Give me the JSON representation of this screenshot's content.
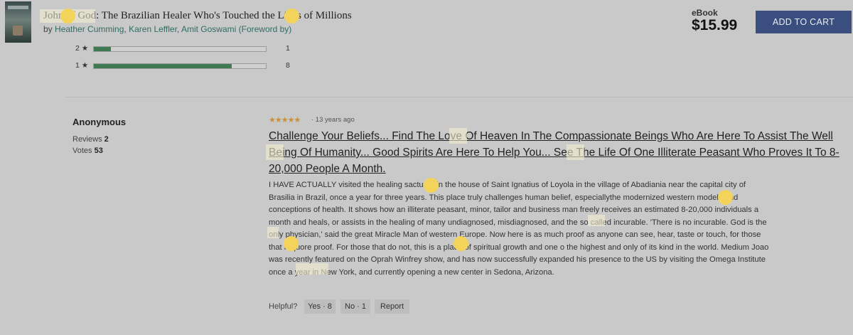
{
  "header": {
    "title": "John of God: The Brazilian Healer Who's Touched the Lives of Millions",
    "by_prefix": "by",
    "authors": [
      "Heather Cumming",
      "Karen Leffler",
      "Amit Goswami (Foreword by)"
    ],
    "separator": ",",
    "format": "eBook",
    "price": "$15.99",
    "add_to_cart": "ADD TO CART"
  },
  "ratings": [
    {
      "label": "2 ★",
      "count": "1",
      "fraction": 0.1
    },
    {
      "label": "1 ★",
      "count": "8",
      "fraction": 0.8
    }
  ],
  "reviewer": {
    "name": "Anonymous",
    "reviews_label": "Reviews",
    "reviews_count": "2",
    "votes_label": "Votes",
    "votes_count": "53"
  },
  "review": {
    "stars": "★★★★★",
    "stars_value": 5,
    "stars_color": "#c9913a",
    "ago": "· 13 years ago",
    "title": "Challenge Your Beliefs... Find The Love Of Heaven In The Compassionate Beings Who Are Here To Assist The Well Being Of Humanity... Good Spirits Are Here To Help You... See The Life Of One Illiterate Peasant Who Proves It To 8-20,000 People A Month.",
    "body": "I HAVE ACTUALLY visited the healing sactuary in the house of Saint Ignatius of Loyola in the village of Abadiania near the capital city of Brasilia in Brazil, once a year for three years. This place truly challenges human belief, especiallythe modernized western models and conceptions of health. It shows how an illiterate peasant, minor, tailor and business man freely receives an estimated 8-20,000 individuals a month and heals, or assists in the healing of many undiagnosed, misdiagnosed, and the so called incurable. 'There is no incurable. God is the only physician,' said the great Miracle Man of western Europe. Now here is as much proof as anyone can see, hear, taste or touch, for those that requore proof. For those that do not, this is a place of spiritual growth and one o the highest and only of its kind in the world. Medium Joao was recently featured on the Oprah Winfrey show, and has now successfully expanded his presence to the US by visiting the Omega Institute once a year in New York, and currently opening a new center in Sedona, Arizona."
  },
  "helpful": {
    "label": "Helpful?",
    "yes": "Yes · 8",
    "no": "No · 1",
    "report": "Report"
  },
  "colors": {
    "background": "#c9c9c9",
    "cart_button": "#3a4e7f",
    "rating_bar": "#3e7a52",
    "highlight": "#f4f0cf",
    "marker": "#f3d35a"
  }
}
